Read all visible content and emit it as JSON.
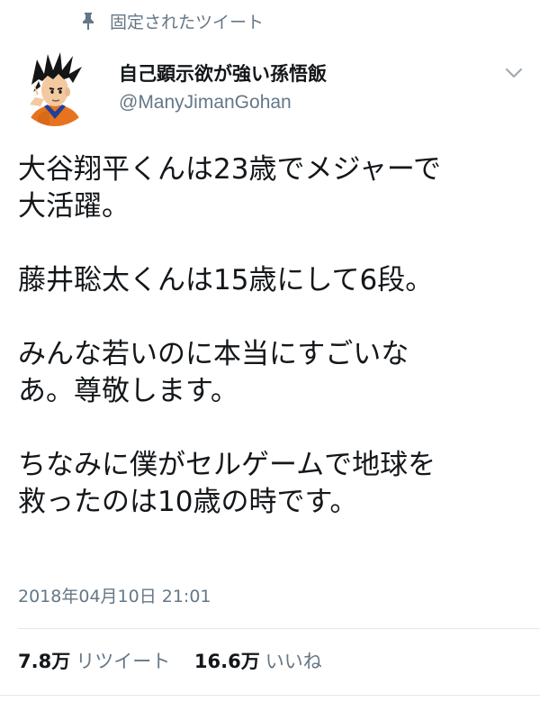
{
  "pinned": {
    "label": "固定されたツイート",
    "icon": "pin-icon"
  },
  "author": {
    "display_name": "自己顕示欲が強い孫悟飯",
    "handle": "@ManyJimanGohan",
    "avatar_icon": "avatar-gohan"
  },
  "menu_icon": "chevron-down-icon",
  "tweet": {
    "paragraphs": [
      "大谷翔平くんは23歳でメジャーで\n大活躍。",
      "藤井聡太くんは15歳にして6段。",
      "みんな若いのに本当にすごいな\nあ。尊敬します。",
      "ちなみに僕がセルゲームで地球を\n救ったのは10歳の時です。"
    ]
  },
  "timestamp": "2018年04月10日 21:01",
  "stats": {
    "retweets": {
      "count": "7.8万",
      "label": "リツイート"
    },
    "likes": {
      "count": "16.6万",
      "label": "いいね"
    }
  },
  "colors": {
    "text": "#14171a",
    "secondary": "#657786",
    "divider": "#e1e8ed"
  }
}
